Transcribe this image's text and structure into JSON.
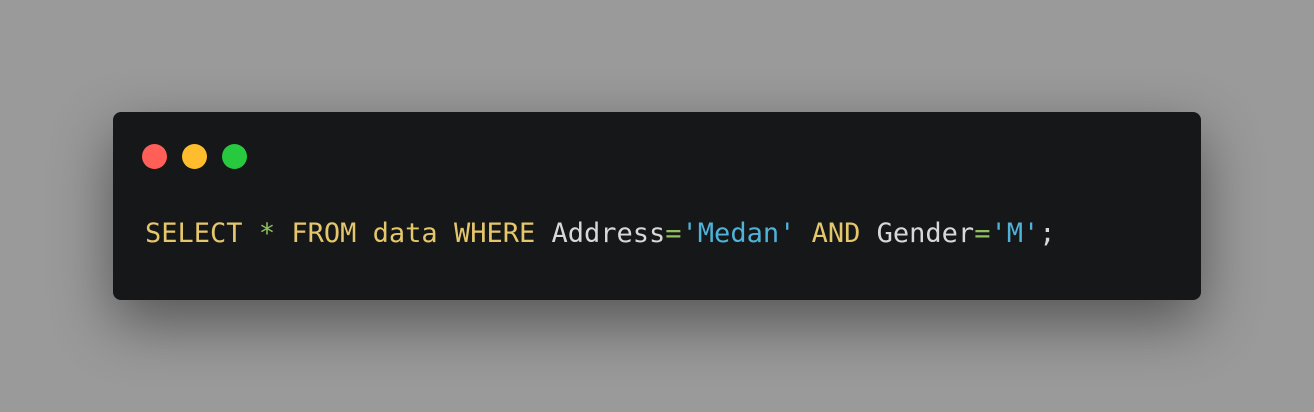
{
  "window": {
    "controls": [
      {
        "name": "close-button",
        "icon": "red-circle-icon",
        "color": "#ff5f56"
      },
      {
        "name": "minimize-button",
        "icon": "yellow-circle-icon",
        "color": "#ffbd2e"
      },
      {
        "name": "zoom-button",
        "icon": "green-circle-icon",
        "color": "#27c93f"
      }
    ]
  },
  "code": {
    "tokens": [
      {
        "text": "SELECT",
        "kind": "keyword"
      },
      {
        "text": " ",
        "kind": "space"
      },
      {
        "text": "*",
        "kind": "operator"
      },
      {
        "text": " ",
        "kind": "space"
      },
      {
        "text": "FROM",
        "kind": "keyword"
      },
      {
        "text": " ",
        "kind": "space"
      },
      {
        "text": "data",
        "kind": "keyword"
      },
      {
        "text": " ",
        "kind": "space"
      },
      {
        "text": "WHERE",
        "kind": "keyword"
      },
      {
        "text": " ",
        "kind": "space"
      },
      {
        "text": "Address",
        "kind": "identifier"
      },
      {
        "text": "=",
        "kind": "operator"
      },
      {
        "text": "'Medan'",
        "kind": "string"
      },
      {
        "text": " ",
        "kind": "space"
      },
      {
        "text": "AND",
        "kind": "keyword"
      },
      {
        "text": " ",
        "kind": "space"
      },
      {
        "text": "Gender",
        "kind": "identifier"
      },
      {
        "text": "=",
        "kind": "operator"
      },
      {
        "text": "'M'",
        "kind": "string"
      },
      {
        "text": ";",
        "kind": "punctuation"
      }
    ]
  },
  "colors": {
    "background": "#9a9a9a",
    "window": "#161719",
    "keyword": "#e5c76b",
    "operator": "#8fc060",
    "identifier": "#d8d8d8",
    "string": "#4fb3d9",
    "punctuation": "#d8d8d8"
  }
}
